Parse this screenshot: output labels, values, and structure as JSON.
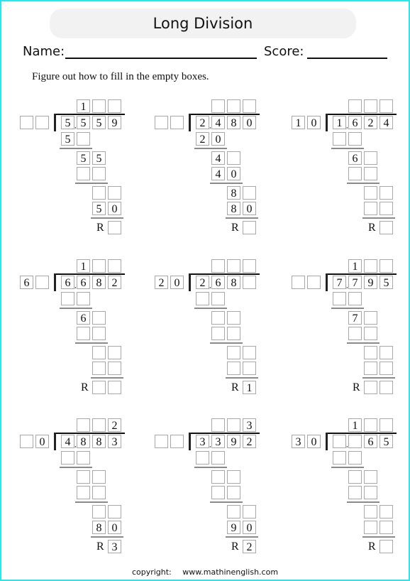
{
  "header": {
    "title": "Long Division",
    "name_label": "Name:",
    "score_label": "Score:",
    "instruction": "Figure out how to fill in the empty boxes."
  },
  "problems": [
    {
      "divisor": [
        "",
        ""
      ],
      "quotient": [
        "1",
        "",
        ""
      ],
      "dividend": [
        "5",
        "5",
        "5",
        "9"
      ],
      "step1_sub": [
        "5",
        ""
      ],
      "step2_bring": [
        "5",
        "5"
      ],
      "step2_sub": [
        "",
        ""
      ],
      "step3_bring": [
        "",
        ""
      ],
      "step3_sub": [
        "5",
        "0"
      ],
      "remainder": [
        ""
      ]
    },
    {
      "divisor": [
        "",
        ""
      ],
      "quotient": [
        "",
        "",
        ""
      ],
      "dividend": [
        "2",
        "4",
        "8",
        "0"
      ],
      "step1_sub": [
        "2",
        "0"
      ],
      "step2_bring": [
        "4",
        ""
      ],
      "step2_sub": [
        "4",
        "0"
      ],
      "step3_bring": [
        "8",
        ""
      ],
      "step3_sub": [
        "8",
        "0"
      ],
      "remainder": [
        ""
      ]
    },
    {
      "divisor": [
        "1",
        "0"
      ],
      "quotient": [
        "",
        "",
        ""
      ],
      "dividend": [
        "1",
        "6",
        "2",
        "4"
      ],
      "step1_sub": [
        "",
        ""
      ],
      "step2_bring": [
        "6",
        ""
      ],
      "step2_sub": [
        "",
        ""
      ],
      "step3_bring": [
        "",
        ""
      ],
      "step3_sub": [
        "",
        ""
      ],
      "remainder": [
        ""
      ]
    },
    {
      "divisor": [
        "6",
        ""
      ],
      "quotient": [
        "1",
        "",
        ""
      ],
      "dividend": [
        "6",
        "6",
        "8",
        "2"
      ],
      "step1_sub": [
        "",
        ""
      ],
      "step2_bring": [
        "6",
        ""
      ],
      "step2_sub": [
        "",
        ""
      ],
      "step3_bring": [
        "",
        ""
      ],
      "step3_sub": [
        "",
        ""
      ],
      "remainder": [
        "",
        ""
      ]
    },
    {
      "divisor": [
        "2",
        "0"
      ],
      "quotient": [
        "",
        "",
        ""
      ],
      "dividend": [
        "2",
        "6",
        "8",
        ""
      ],
      "step1_sub": [
        "",
        ""
      ],
      "step2_bring": [
        "",
        ""
      ],
      "step2_sub": [
        "",
        ""
      ],
      "step3_bring": [
        "",
        ""
      ],
      "step3_sub": [
        "",
        ""
      ],
      "remainder": [
        "1"
      ]
    },
    {
      "divisor": [
        "",
        ""
      ],
      "quotient": [
        "1",
        "",
        ""
      ],
      "dividend": [
        "7",
        "7",
        "9",
        "5"
      ],
      "step1_sub": [
        "",
        ""
      ],
      "step2_bring": [
        "7",
        ""
      ],
      "step2_sub": [
        "",
        ""
      ],
      "step3_bring": [
        "",
        ""
      ],
      "step3_sub": [
        "",
        ""
      ],
      "remainder": [
        "",
        ""
      ]
    },
    {
      "divisor": [
        "",
        "0"
      ],
      "quotient": [
        "",
        "",
        "2"
      ],
      "dividend": [
        "4",
        "8",
        "8",
        "3"
      ],
      "step1_sub": [
        "",
        ""
      ],
      "step2_bring": [
        "",
        ""
      ],
      "step2_sub": [
        "",
        ""
      ],
      "step3_bring": [
        "",
        ""
      ],
      "step3_sub": [
        "8",
        "0"
      ],
      "remainder": [
        "3"
      ]
    },
    {
      "divisor": [
        "",
        ""
      ],
      "quotient": [
        "",
        "",
        "3"
      ],
      "dividend": [
        "3",
        "3",
        "9",
        "2"
      ],
      "step1_sub": [
        "",
        ""
      ],
      "step2_bring": [
        "",
        ""
      ],
      "step2_sub": [
        "",
        ""
      ],
      "step3_bring": [
        "",
        ""
      ],
      "step3_sub": [
        "9",
        "0"
      ],
      "remainder": [
        "2"
      ]
    },
    {
      "divisor": [
        "3",
        "0"
      ],
      "quotient": [
        "1",
        "",
        ""
      ],
      "dividend": [
        "",
        "",
        "6",
        "5"
      ],
      "step1_sub": [
        "",
        ""
      ],
      "step2_bring": [
        "",
        ""
      ],
      "step2_sub": [
        "",
        ""
      ],
      "step3_bring": [
        "",
        ""
      ],
      "step3_sub": [
        "",
        ""
      ],
      "remainder": [
        ""
      ]
    }
  ],
  "remainder_label": "R",
  "footer": {
    "copyright_label": "copyright:",
    "site": "www.mathinenglish.com"
  },
  "colors": {
    "border": "#2ee6e6",
    "title_background": "#f2f2f2",
    "box_border": "#a8a8a8"
  }
}
